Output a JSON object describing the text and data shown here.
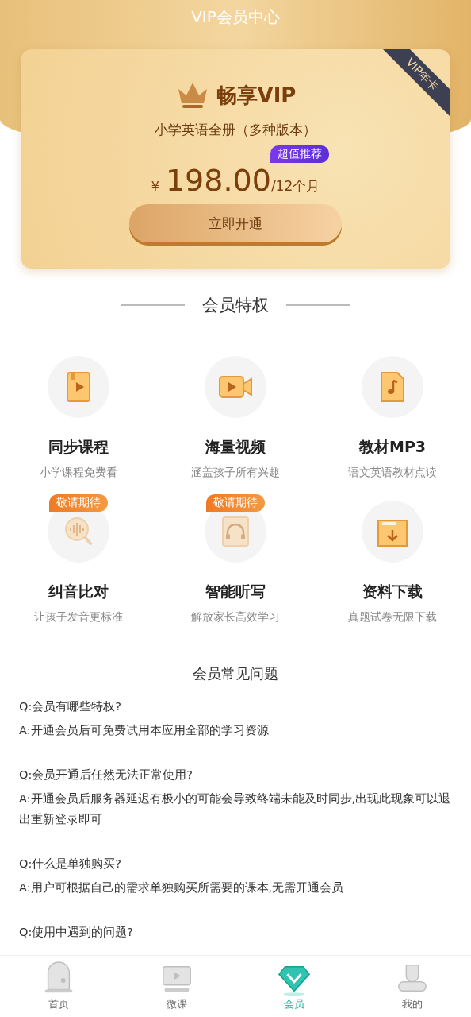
{
  "header": {
    "title": "VIP会员中心"
  },
  "card": {
    "ribbon": "VIP年卡",
    "title": "畅享VIP",
    "subtitle": "小学英语全册（多种版本）",
    "badge": "超值推荐",
    "currency": "¥",
    "price": "198.00",
    "period": "/12个月",
    "button": "立即开通"
  },
  "privileges": {
    "title": "会员特权",
    "items": [
      {
        "title": "同步课程",
        "subtitle": "小学课程免费看",
        "disabled": false
      },
      {
        "title": "海量视频",
        "subtitle": "涵盖孩子所有兴趣",
        "disabled": false
      },
      {
        "title": "教材MP3",
        "subtitle": "语文英语教材点读",
        "disabled": false
      },
      {
        "title": "纠音比对",
        "subtitle": "让孩子发音更标准",
        "badge": "敬请期待",
        "disabled": true
      },
      {
        "title": "智能听写",
        "subtitle": "解放家长高效学习",
        "badge": "敬请期待",
        "disabled": true
      },
      {
        "title": "资料下载",
        "subtitle": "真题试卷无限下载",
        "disabled": false
      }
    ]
  },
  "faq": {
    "title": "会员常见问题",
    "items": [
      {
        "q": "Q:会员有哪些特权?",
        "a": "A:开通会员后可免费试用本应用全部的学习资源"
      },
      {
        "q": "Q:会员开通后任然无法正常使用?",
        "a": "A:开通会员后服务器延迟有极小的可能会导致终端未能及时同步,出现此现象可以退出重新登录即可"
      },
      {
        "q": "Q:什么是单独购买?",
        "a": "A:用户可根据自己的需求单独购买所需要的课本,无需开通会员"
      },
      {
        "q": "Q:使用中遇到的问题?"
      }
    ]
  },
  "tabbar": [
    {
      "label": "首页",
      "selected": false
    },
    {
      "label": "微课",
      "selected": false
    },
    {
      "label": "会员",
      "selected": true
    },
    {
      "label": "我的",
      "selected": false
    }
  ]
}
